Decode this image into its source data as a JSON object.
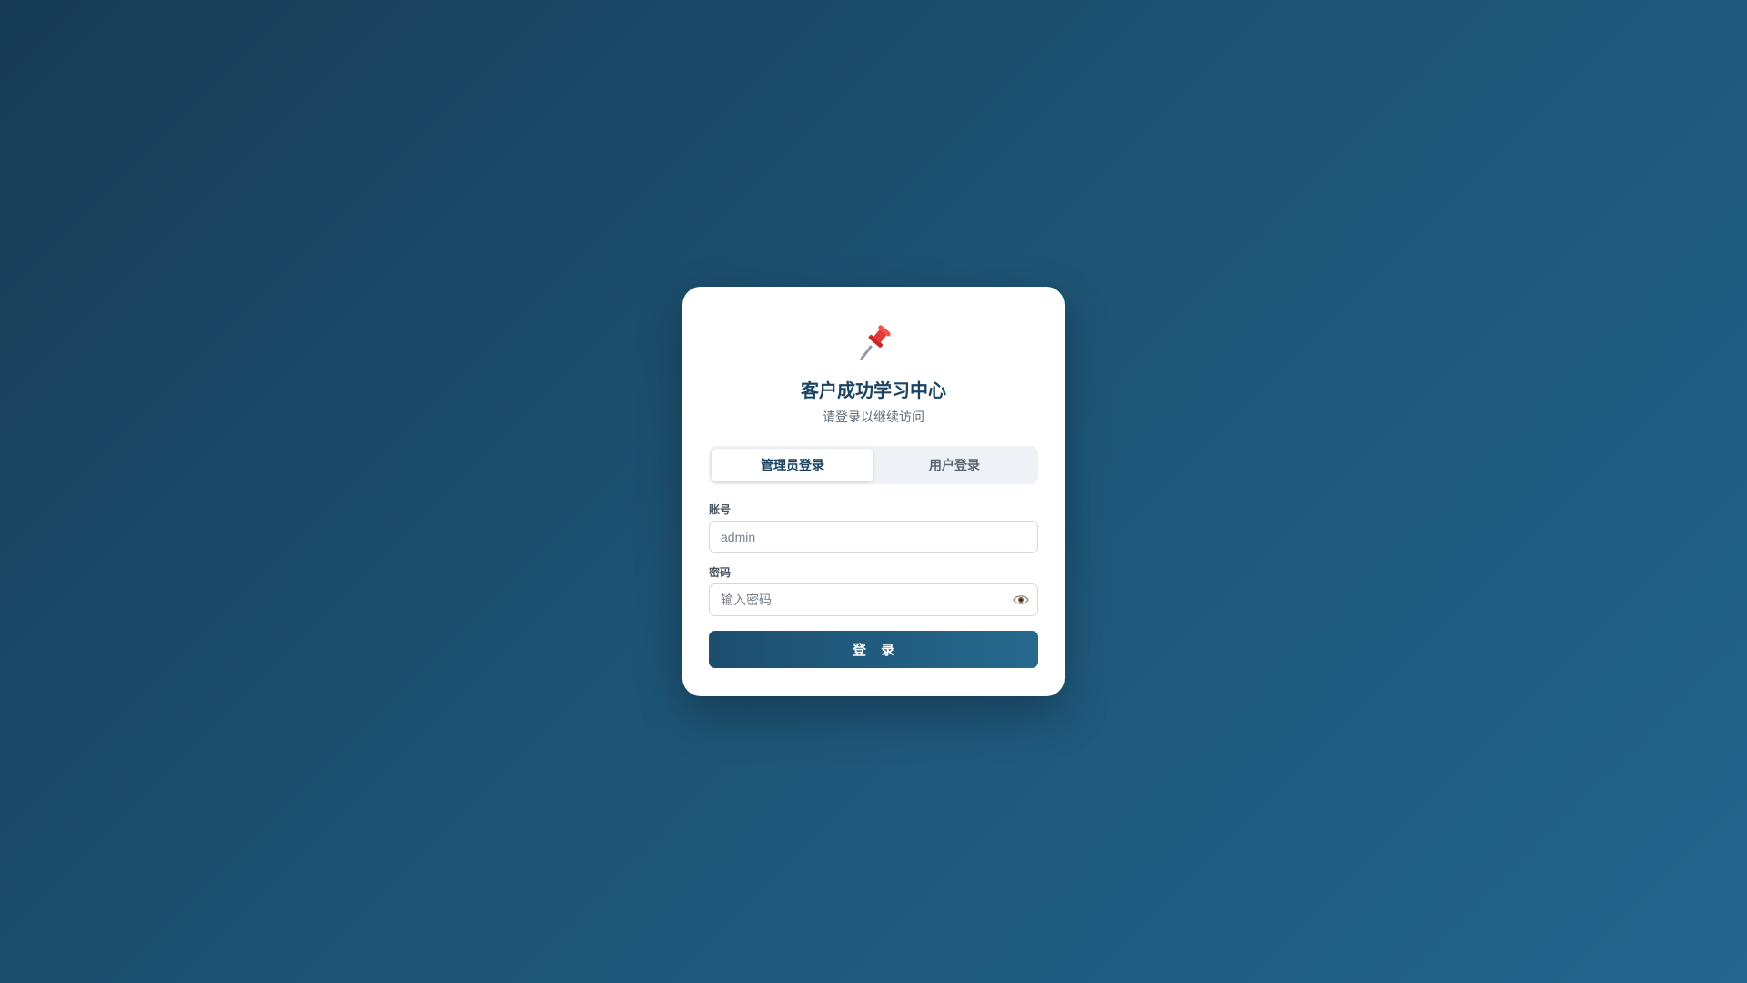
{
  "header": {
    "logo_icon": "pushpin-icon",
    "title": "客户成功学习中心",
    "subtitle": "请登录以继续访问"
  },
  "tabs": [
    {
      "label": "管理员登录",
      "active": true
    },
    {
      "label": "用户登录",
      "active": false
    }
  ],
  "form": {
    "account_label": "账号",
    "account_placeholder": "admin",
    "account_value": "",
    "password_label": "密码",
    "password_placeholder": "输入密码",
    "password_value": "",
    "toggle_icon": "eye-icon",
    "submit_label": "登 录"
  },
  "colors": {
    "accent": "#1b4463",
    "button_start": "#1c4e6e",
    "button_end": "#26698f",
    "background_start": "#173b55",
    "background_end": "#23658e"
  }
}
